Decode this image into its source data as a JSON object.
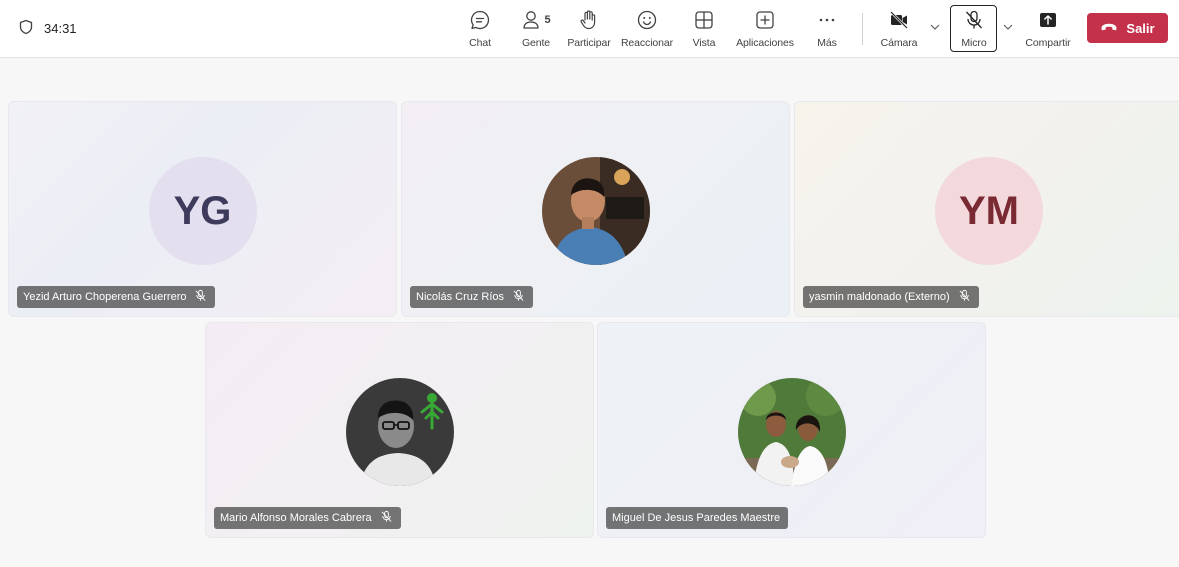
{
  "meeting": {
    "timer": "34:31"
  },
  "toolbar": {
    "chat_label": "Chat",
    "people_label": "Gente",
    "people_count": "5",
    "raise_label": "Participar",
    "react_label": "Reaccionar",
    "view_label": "Vista",
    "apps_label": "Aplicaciones",
    "more_label": "Más",
    "camera_label": "Cámara",
    "mic_label": "Micro",
    "share_label": "Compartir",
    "leave_label": "Salir"
  },
  "participants": [
    {
      "name": "Yezid Arturo Choperena Guerrero",
      "initials": "YG",
      "muted": true
    },
    {
      "name": "Nicolás Cruz Ríos",
      "muted": true
    },
    {
      "name": "yasmin maldonado (Externo)",
      "initials": "YM",
      "muted": true
    },
    {
      "name": "Mario Alfonso Morales Cabrera",
      "muted": true
    },
    {
      "name": "Miguel De Jesus Paredes Maestre",
      "muted": false
    }
  ],
  "colors": {
    "leave_button": "#c4314b",
    "avatar_yg_bg": "#e3dfee",
    "avatar_ym_bg": "#f3d9dc",
    "name_tag_bg": "#505050"
  },
  "icons": {
    "timer": "shield-icon",
    "chat": "chat-icon",
    "people": "people-icon",
    "raise": "raise-hand-icon",
    "react": "smiley-icon",
    "view": "grid-view-icon",
    "apps": "add-apps-icon",
    "more": "more-dots-icon",
    "camera": "camera-off-icon",
    "mic": "mic-off-icon",
    "share": "share-screen-icon",
    "leave": "phone-hangup-icon"
  }
}
